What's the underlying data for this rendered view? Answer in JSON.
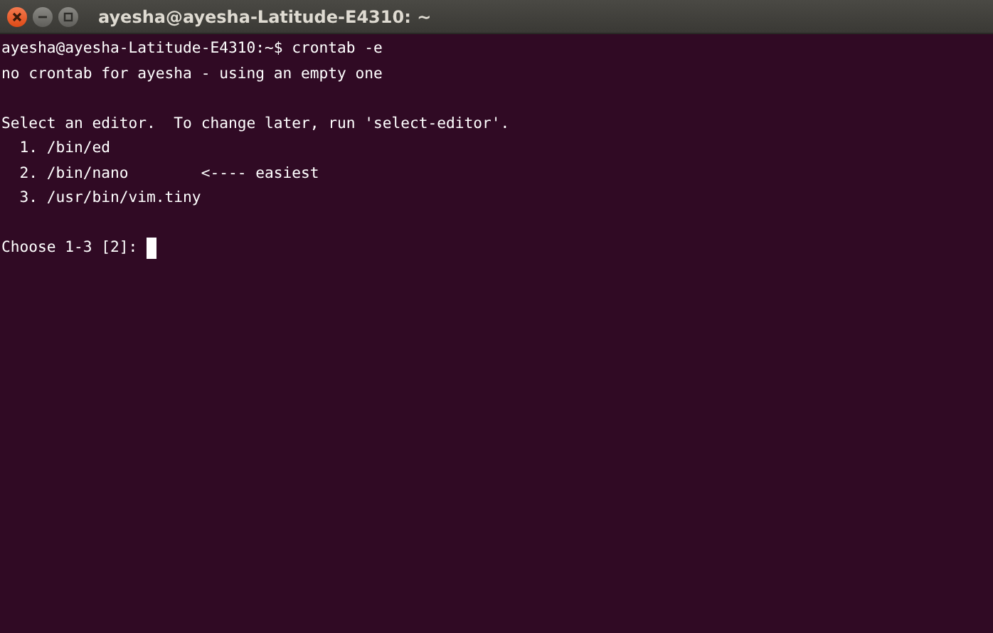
{
  "window": {
    "title": "ayesha@ayesha-Latitude-E4310: ~"
  },
  "terminal": {
    "blocks": [
      {
        "lines": [
          "ayesha@ayesha-Latitude-E4310:~$ crontab -e",
          "no crontab for ayesha - using an empty one"
        ]
      },
      {
        "lines": [
          "Select an editor.  To change later, run 'select-editor'.",
          "  1. /bin/ed",
          "  2. /bin/nano        <---- easiest",
          "  3. /usr/bin/vim.tiny"
        ]
      }
    ],
    "prompt": {
      "text": "Choose 1-3 [2]: ",
      "cursor": true
    }
  }
}
